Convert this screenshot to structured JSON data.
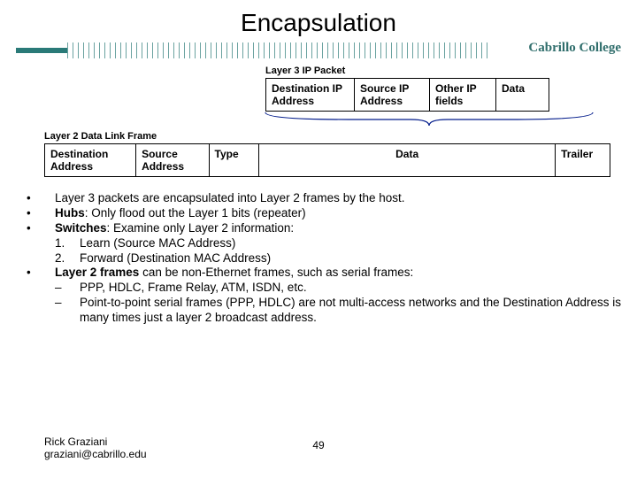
{
  "title": "Encapsulation",
  "brand": "Cabrillo College",
  "layer3": {
    "label": "Layer 3 IP Packet",
    "cells": [
      "Destination IP Address",
      "Source IP Address",
      "Other IP fields",
      "Data"
    ]
  },
  "layer2": {
    "label": "Layer 2 Data Link Frame",
    "cells": [
      "Destination Address",
      "Source Address",
      "Type",
      "Data",
      "Trailer"
    ]
  },
  "bullets": {
    "b1": "Layer 3 packets are encapsulated into Layer 2 frames by the host.",
    "b2_pre": "Hubs",
    "b2_rest": ": Only flood out the Layer 1 bits (repeater)",
    "b3_pre": "Switches",
    "b3_rest": ": Examine only Layer 2 information:",
    "b3_1": "Learn (Source MAC Address)",
    "b3_2": "Forward (Destination MAC Address)",
    "b4_pre": "Layer 2 frames",
    "b4_rest": " can be non-Ethernet frames, such as serial frames:",
    "b4_d1": "PPP, HDLC, Frame Relay, ATM, ISDN, etc.",
    "b4_d2": "Point-to-point serial frames (PPP, HDLC) are not multi-access networks and the Destination Address is many times just a layer 2 broadcast address."
  },
  "footer": {
    "name": "Rick Graziani",
    "email": "graziani@cabrillo.edu",
    "page": "49"
  }
}
